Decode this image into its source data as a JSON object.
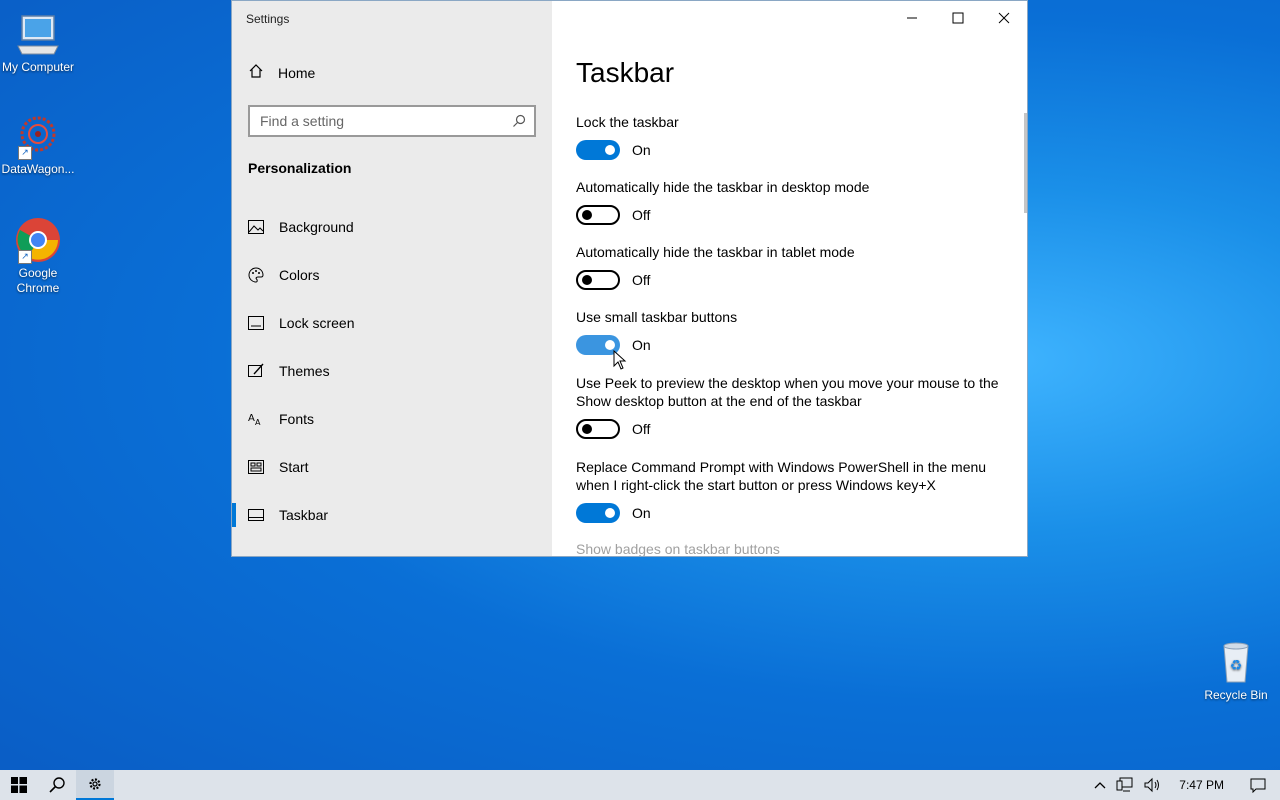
{
  "desktop": {
    "icons": [
      {
        "label": "My Computer"
      },
      {
        "label": "DataWagon..."
      },
      {
        "label": "Google Chrome"
      },
      {
        "label": "Recycle Bin"
      }
    ]
  },
  "window": {
    "title": "Settings",
    "home_label": "Home",
    "search_placeholder": "Find a setting",
    "section": "Personalization",
    "nav": [
      {
        "label": "Background",
        "icon": "picture-icon"
      },
      {
        "label": "Colors",
        "icon": "palette-icon"
      },
      {
        "label": "Lock screen",
        "icon": "lock-screen-icon"
      },
      {
        "label": "Themes",
        "icon": "themes-icon"
      },
      {
        "label": "Fonts",
        "icon": "fonts-icon"
      },
      {
        "label": "Start",
        "icon": "start-icon"
      },
      {
        "label": "Taskbar",
        "icon": "taskbar-icon",
        "active": true
      }
    ]
  },
  "page": {
    "title": "Taskbar",
    "settings": [
      {
        "label": "Lock the taskbar",
        "state": "On"
      },
      {
        "label": "Automatically hide the taskbar in desktop mode",
        "state": "Off"
      },
      {
        "label": "Automatically hide the taskbar in tablet mode",
        "state": "Off"
      },
      {
        "label": "Use small taskbar buttons",
        "state": "On"
      },
      {
        "label": "Use Peek to preview the desktop when you move your mouse to the Show desktop button at the end of the taskbar",
        "state": "Off"
      },
      {
        "label": "Replace Command Prompt with Windows PowerShell in the menu when I right-click the start button or press Windows key+X",
        "state": "On"
      }
    ],
    "next_setting": "Show badges on taskbar buttons"
  },
  "taskbar": {
    "clock": "7:47 PM"
  },
  "colors": {
    "accent": "#0078d7"
  }
}
